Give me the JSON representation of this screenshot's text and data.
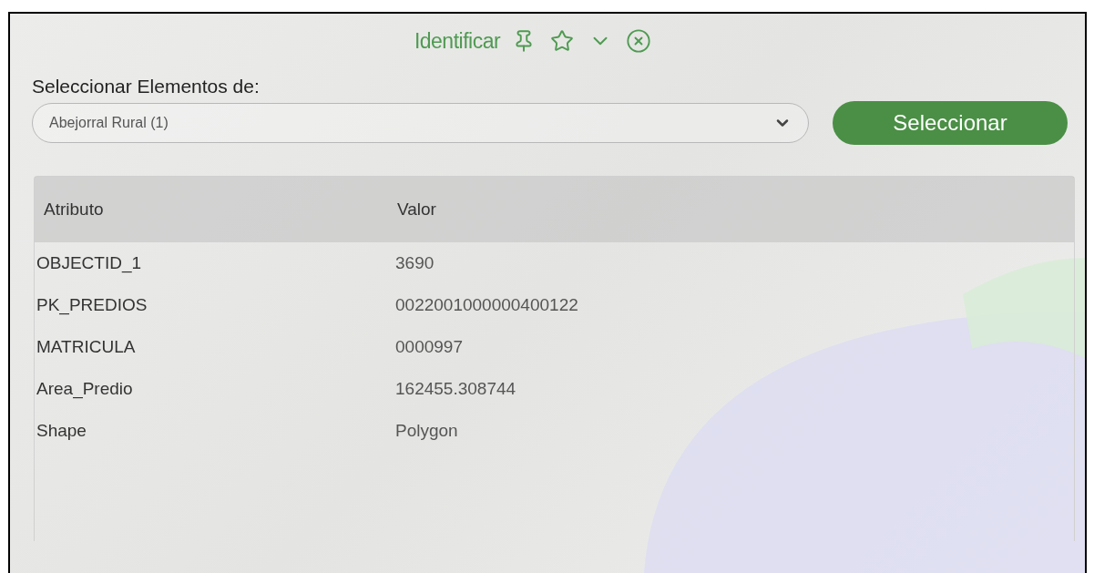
{
  "panel": {
    "title": "Identificar",
    "select_label": "Seleccionar Elementos de:",
    "select": {
      "value": "Abejorral Rural (1)"
    },
    "button": "Seleccionar"
  },
  "table": {
    "columns": [
      "Atributo",
      "Valor"
    ],
    "rows": [
      [
        "OBJECTID_1",
        "3690"
      ],
      [
        "PK_PREDIOS",
        "0022001000000400122"
      ],
      [
        "MATRICULA",
        "0000997"
      ],
      [
        "Area_Predio",
        "162455.308744"
      ],
      [
        "Shape",
        "Polygon"
      ]
    ]
  }
}
